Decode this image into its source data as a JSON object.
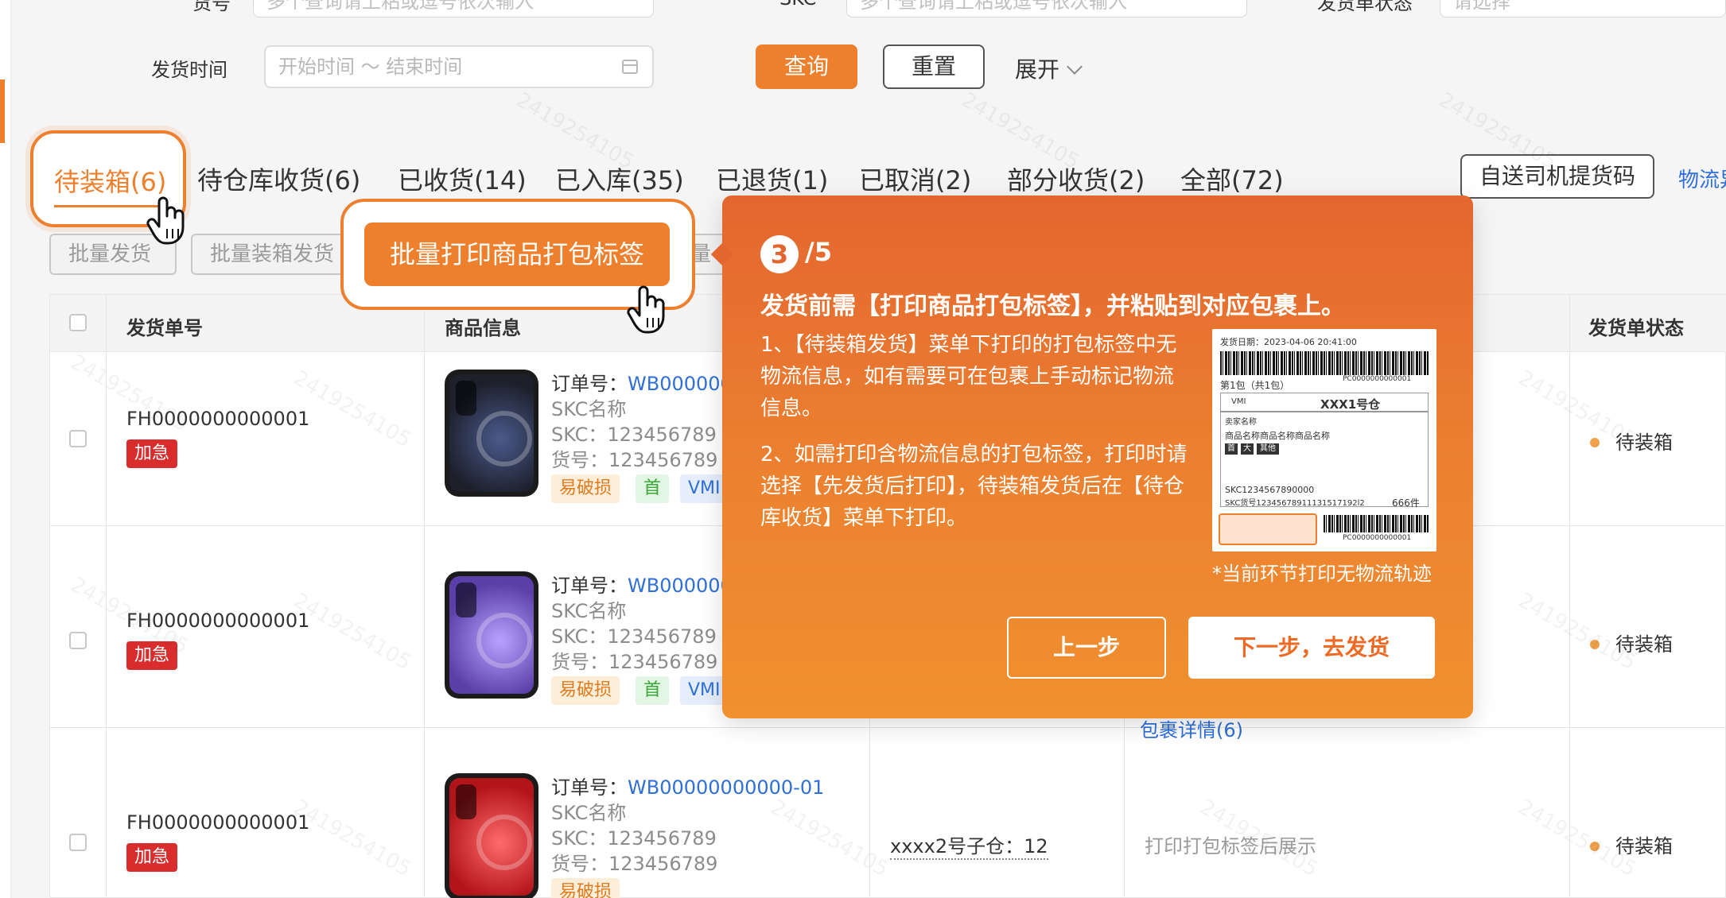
{
  "filters": {
    "row1_placeholder_a": "多个查询请上粘或逗号依次输入",
    "row1_label_skc": "SKC",
    "row1_placeholder_b": "多个查询请上粘或逗号依次输入",
    "row1_label_status": "发货单状态",
    "row1_placeholder_c": "请选择",
    "row1_label_a": "货号",
    "ship_time_label": "发货时间",
    "ship_time_placeholder": "开始时间 ～ 结束时间",
    "query_label": "查询",
    "reset_label": "重置",
    "expand_label": "展开"
  },
  "tabs": [
    {
      "label": "待装箱(6)"
    },
    {
      "label": "待仓库收货(6)"
    },
    {
      "label": "已收货(14)"
    },
    {
      "label": "已入库(35)"
    },
    {
      "label": "已退货(1)"
    },
    {
      "label": "已取消(2)"
    },
    {
      "label": "部分收货(2)"
    },
    {
      "label": "全部(72)"
    }
  ],
  "header_actions": {
    "driver_code": "自送司机提货码",
    "logistics": "物流异"
  },
  "toolbar": {
    "batch_ship": "批量发货",
    "batch_pack_ship": "批量装箱发货",
    "batch_print_label": "批量打印商品打包标签",
    "hidden_fragment": "量"
  },
  "table": {
    "headers": {
      "order_no": "发货单号",
      "product_info": "商品信息",
      "status": "发货单状态"
    },
    "rows": [
      {
        "order_no": "FH0000000000001",
        "urgent": "加急",
        "order_prefix": "订单号：",
        "order_id": "WB000000",
        "skc_name": "SKC名称",
        "skc": "SKC：123456789",
        "item_no": "货号：123456789",
        "tags": [
          "易破损",
          "首",
          "VMI"
        ],
        "status": "待装箱",
        "phone_color": "#1d1f2b"
      },
      {
        "order_no": "FH0000000000001",
        "urgent": "加急",
        "order_prefix": "订单号：",
        "order_id": "WB000000",
        "skc_name": "SKC名称",
        "skc": "SKC：123456789",
        "item_no": "货号：123456789",
        "tags": [
          "易破损",
          "首",
          "VMI"
        ],
        "package_link": "包裹详情(6)",
        "status": "待装箱",
        "phone_color": "#7b63c9"
      },
      {
        "order_no": "FH0000000000001",
        "urgent": "加急",
        "order_prefix": "订单号：",
        "order_id": "WB00000000000-01",
        "skc_name": "SKC名称",
        "skc": "SKC：123456789",
        "item_no": "货号：123456789",
        "tags": [
          "易破损"
        ],
        "warehouse": "xxxx2号子仓：12",
        "package_note": "打印打包标签后展示",
        "status": "待装箱",
        "phone_color": "#d8262c"
      }
    ]
  },
  "tour": {
    "step": "3",
    "total": "/5",
    "title": "发货前需【打印商品打包标签】，并粘贴到对应包裹上。",
    "para1": "1、【待装箱发货】菜单下打印的打包标签中无物流信息，如有需要可在包裹上手动标记物流信息。",
    "para2": "2、如需打印含物流信息的打包标签，打印时请选择【先发货后打印】，待装箱发货后在【待仓库收货】菜单下打印。",
    "note": "*当前环节打印无物流轨迹",
    "prev": "上一步",
    "next": "下一步，去发货",
    "label_sample": {
      "date": "发货日期：2023-04-06 20:41:00",
      "package": "第1包（共1包）",
      "code_small": "PC0000000000001",
      "vmi": "VMI",
      "warehouse": "XXX1号仓",
      "seller": "卖家名称",
      "product_name": "商品名称商品名称商品名称",
      "mini_tags": [
        "首",
        "大",
        "其他"
      ],
      "skc_line": "SKC1234567890000",
      "skc_item_line": "SKC货号12345678911131517192l2",
      "qty": "666件",
      "code_bottom": "PC0000000000001"
    }
  },
  "watermark": "2419254105",
  "colors": {
    "accent": "#ee7f2d",
    "link": "#2f6fd8",
    "urgent": "#d92d2d"
  }
}
